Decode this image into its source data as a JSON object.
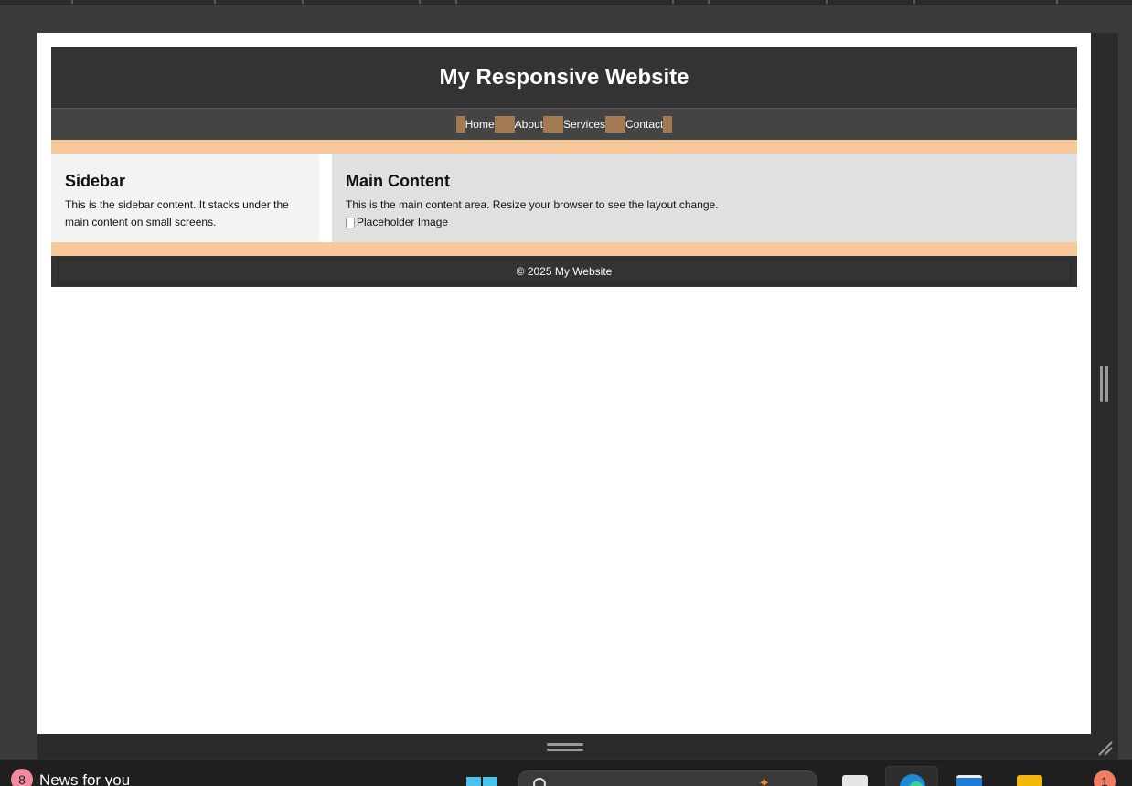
{
  "site": {
    "title": "My Responsive Website",
    "nav": [
      {
        "label": "Home"
      },
      {
        "label": "About"
      },
      {
        "label": "Services"
      },
      {
        "label": "Contact"
      }
    ],
    "sidebar": {
      "heading": "Sidebar",
      "text": "This is the sidebar content. It stacks under the main content on small screens."
    },
    "main": {
      "heading": "Main Content",
      "text": "This is the main content area. Resize your browser to see the layout change.",
      "image_alt": "Placeholder Image"
    },
    "footer": "© 2025 My Website"
  },
  "taskbar": {
    "news_badge": "8",
    "news_label": "News for you",
    "notification_badge": "1"
  },
  "colors": {
    "header_bg": "#333333",
    "nav_bg": "#444444",
    "nav_gap": "#a47a52",
    "band": "#f5c99a",
    "sidebar_bg": "#f3f3f3",
    "main_bg": "#e0e0e0"
  }
}
